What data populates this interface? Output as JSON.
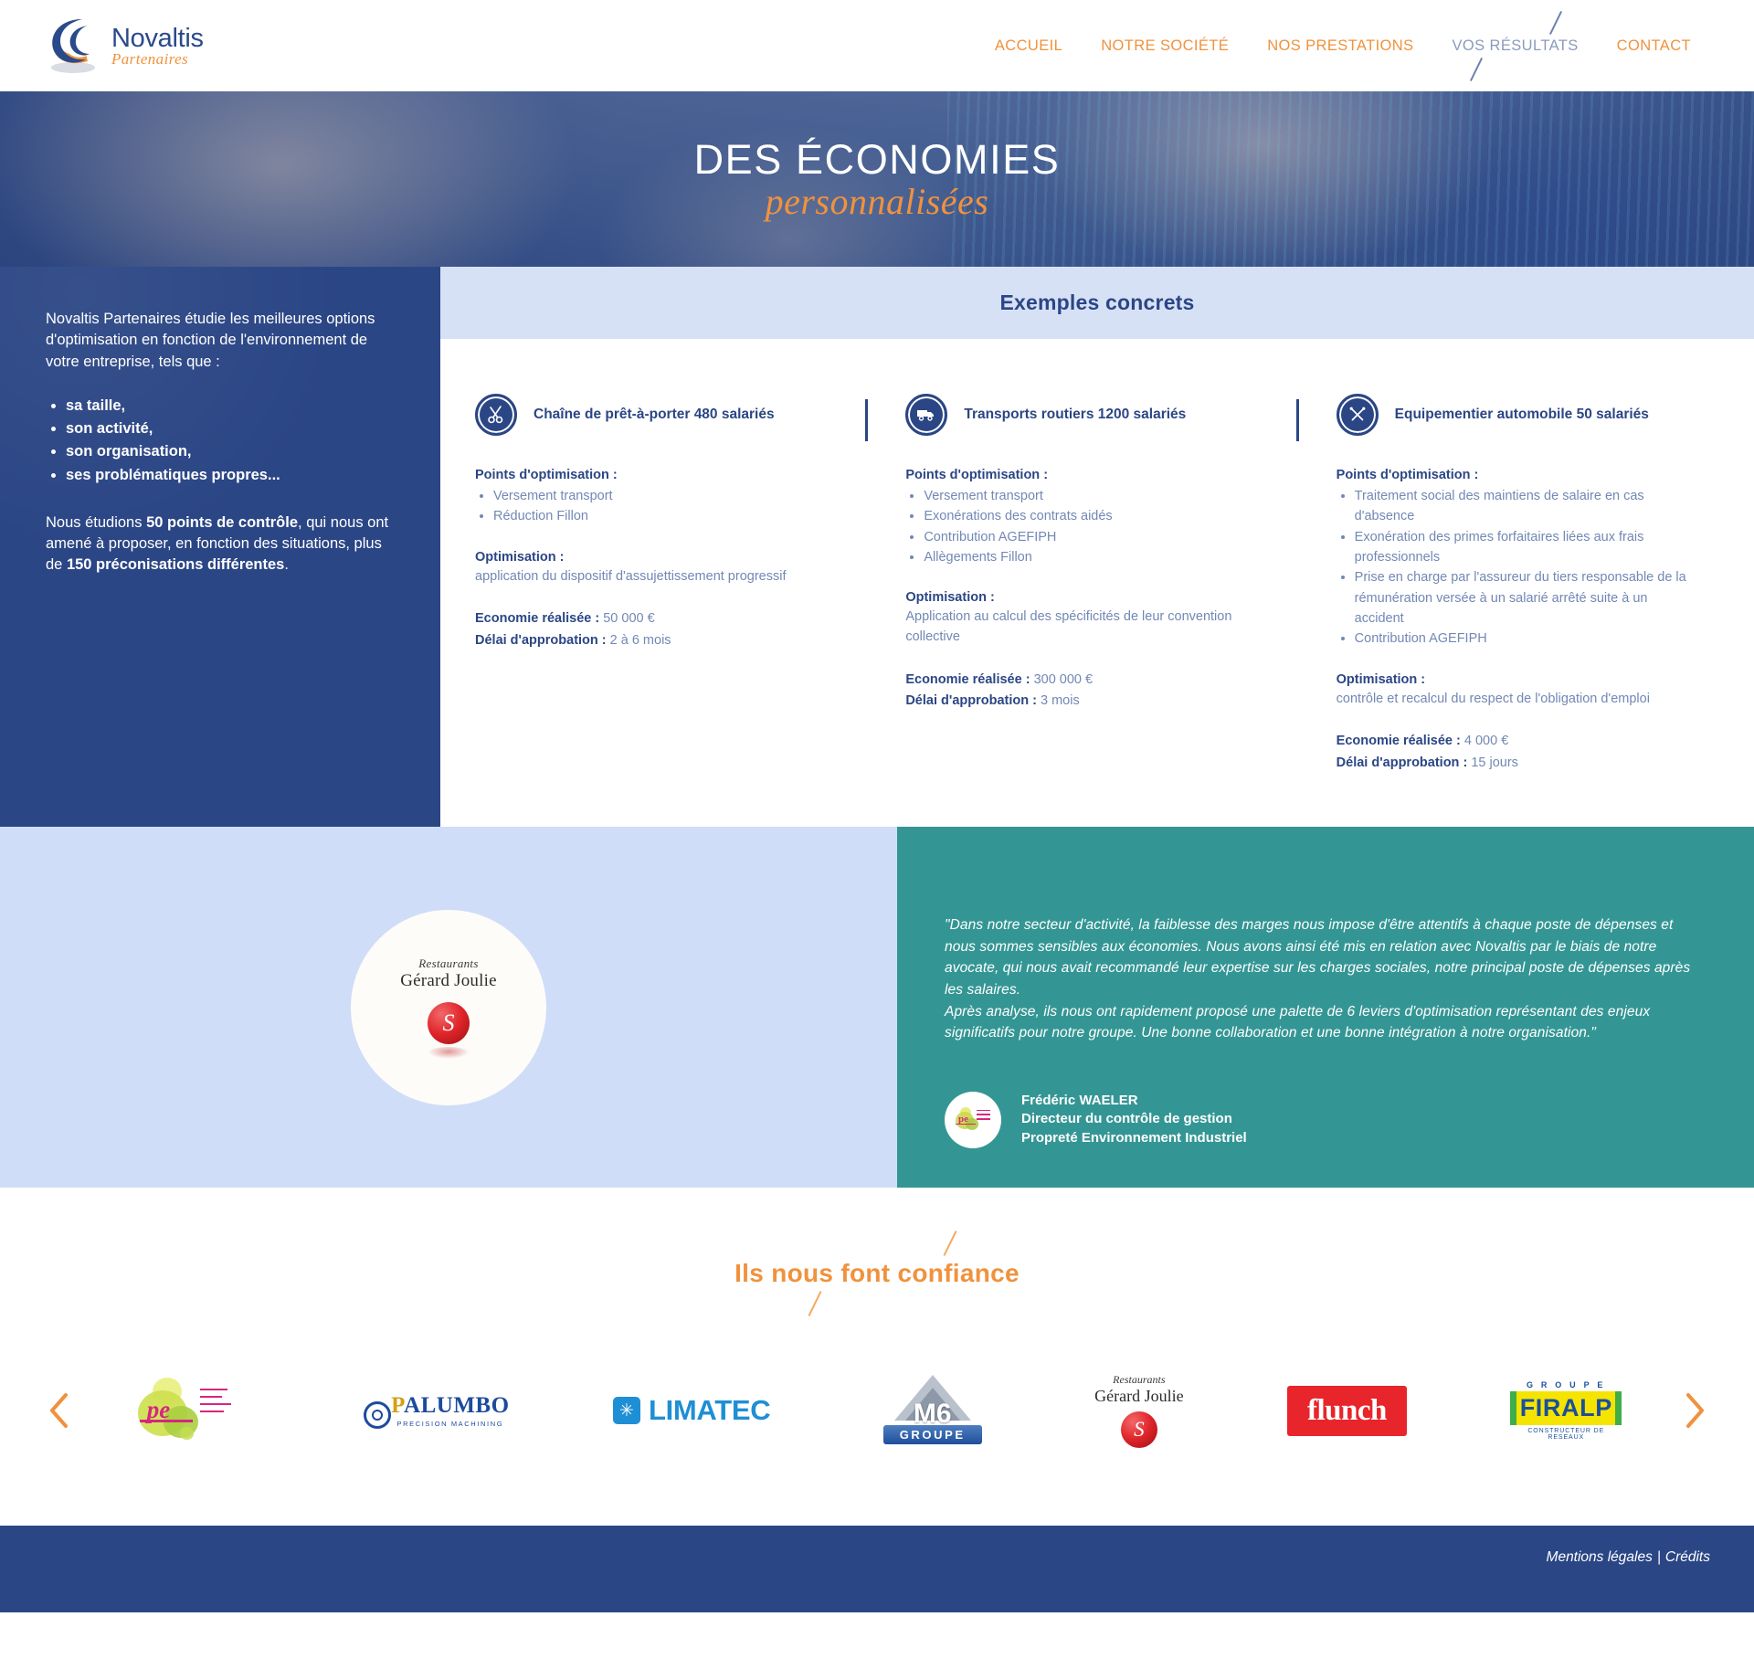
{
  "brand": {
    "name": "Novaltis",
    "tagline": "Partenaires"
  },
  "nav": {
    "items": [
      {
        "label": "ACCUEIL",
        "active": false
      },
      {
        "label": "NOTRE SOCIÉTÉ",
        "active": false
      },
      {
        "label": "NOS PRESTATIONS",
        "active": false
      },
      {
        "label": "VOS RÉSULTATS",
        "active": true
      },
      {
        "label": "CONTACT",
        "active": false
      }
    ]
  },
  "hero": {
    "line1": "DES ÉCONOMIES",
    "line2": "personnalisées"
  },
  "aside": {
    "intro": "Novaltis Partenaires étudie les meilleures options d'optimisation en fonction de l'environnement de votre entreprise, tels que :",
    "bullets": [
      "sa taille,",
      "son activité,",
      "son organisation,",
      "ses problématiques propres..."
    ],
    "closing_pre": "Nous étudions ",
    "closing_b1": "50 points de contrôle",
    "closing_mid": ", qui nous ont amené à proposer, en fonction des situations, plus de ",
    "closing_b2": "150 préconisations différentes",
    "closing_end": "."
  },
  "examples": {
    "title": "Exemples concrets",
    "labels": {
      "points": "Points d'optimisation",
      "optimisation": "Optimisation",
      "economie": "Economie réalisée",
      "delai": "Délai d'approbation",
      "colon": " :"
    },
    "cards": [
      {
        "icon": "scissors-icon",
        "title": "Chaîne de prêt-à-porter 480 salariés",
        "points": [
          "Versement transport",
          "Réduction Fillon"
        ],
        "optimisation": "application du dispositif d'assujettissement progressif",
        "economie": "50 000 €",
        "delai": "2 à 6 mois"
      },
      {
        "icon": "truck-icon",
        "title": "Transports routiers 1200 salariés",
        "points": [
          "Versement transport",
          "Exonérations des contrats aidés",
          "Contribution AGEFIPH",
          "Allègements Fillon"
        ],
        "optimisation": "Application au calcul des spécificités de leur convention collective",
        "economie": "300 000 €",
        "delai": "3 mois"
      },
      {
        "icon": "tools-icon",
        "title": "Equipementier automobile 50 salariés",
        "points": [
          "Traitement social des maintiens de salaire en cas d'absence",
          "Exonération des primes forfaitaires liées aux frais professionnels",
          "Prise en charge par l'assureur du tiers responsable de la rémunération versée à un salarié arrêté suite à un accident",
          "Contribution AGEFIPH"
        ],
        "optimisation": "contrôle et recalcul du respect de l'obligation d'emploi",
        "economie": "4 000 €",
        "delai": "15 jours"
      }
    ]
  },
  "testimonial": {
    "client_logo": {
      "script": "Restaurants",
      "name": "Gérard Joulie"
    },
    "quote_p1": "\"Dans notre secteur d'activité, la faiblesse des marges nous impose d'être attentifs à chaque poste de dépenses et nous sommes sensibles aux économies. Nous avons ainsi été mis en relation avec Novaltis par le biais de notre avocate, qui nous avait recommandé leur expertise sur les charges sociales, notre principal poste de dépenses après les salaires.",
    "quote_p2": "Après analyse, ils nous ont rapidement proposé une palette de 6 leviers d'optimisation représentant des enjeux significatifs pour notre groupe. Une bonne collaboration et une bonne intégration à notre organisation.\"",
    "author_name": "Frédéric WAELER",
    "author_role_1": "Directeur du contrôle de gestion",
    "author_role_2": "Propreté Environnement Industriel"
  },
  "partners": {
    "title": "Ils nous font confiance",
    "prev_label": "‹",
    "next_label": "›",
    "logos": [
      {
        "name": "pe-logo",
        "text": "pe"
      },
      {
        "name": "palumbo-logo",
        "word_a": "P",
        "word_b": "ALUMBO",
        "tagline": "PRECISION MACHINING"
      },
      {
        "name": "limatec-logo",
        "text": "LIMATEC"
      },
      {
        "name": "m6-logo",
        "text": "M6",
        "sub": "GROUPE"
      },
      {
        "name": "gerard-joulie-logo",
        "script": "Restaurants",
        "text": "Gérard Joulie"
      },
      {
        "name": "flunch-logo",
        "text": "flunch"
      },
      {
        "name": "firalp-logo",
        "top": "G R O U P E",
        "text": "FIRALP",
        "bottom": "CONSTRUCTEUR DE RESEAUX"
      }
    ]
  },
  "footer": {
    "legal": "Mentions légales",
    "separator": "|",
    "credits": "Crédits"
  },
  "colors": {
    "brand_blue": "#2b4685",
    "brand_orange": "#f0923d",
    "teal": "#349694",
    "light_blue": "#d7e1f6",
    "pale_blue": "#d0ddf8",
    "muted_text": "#7288b5"
  }
}
